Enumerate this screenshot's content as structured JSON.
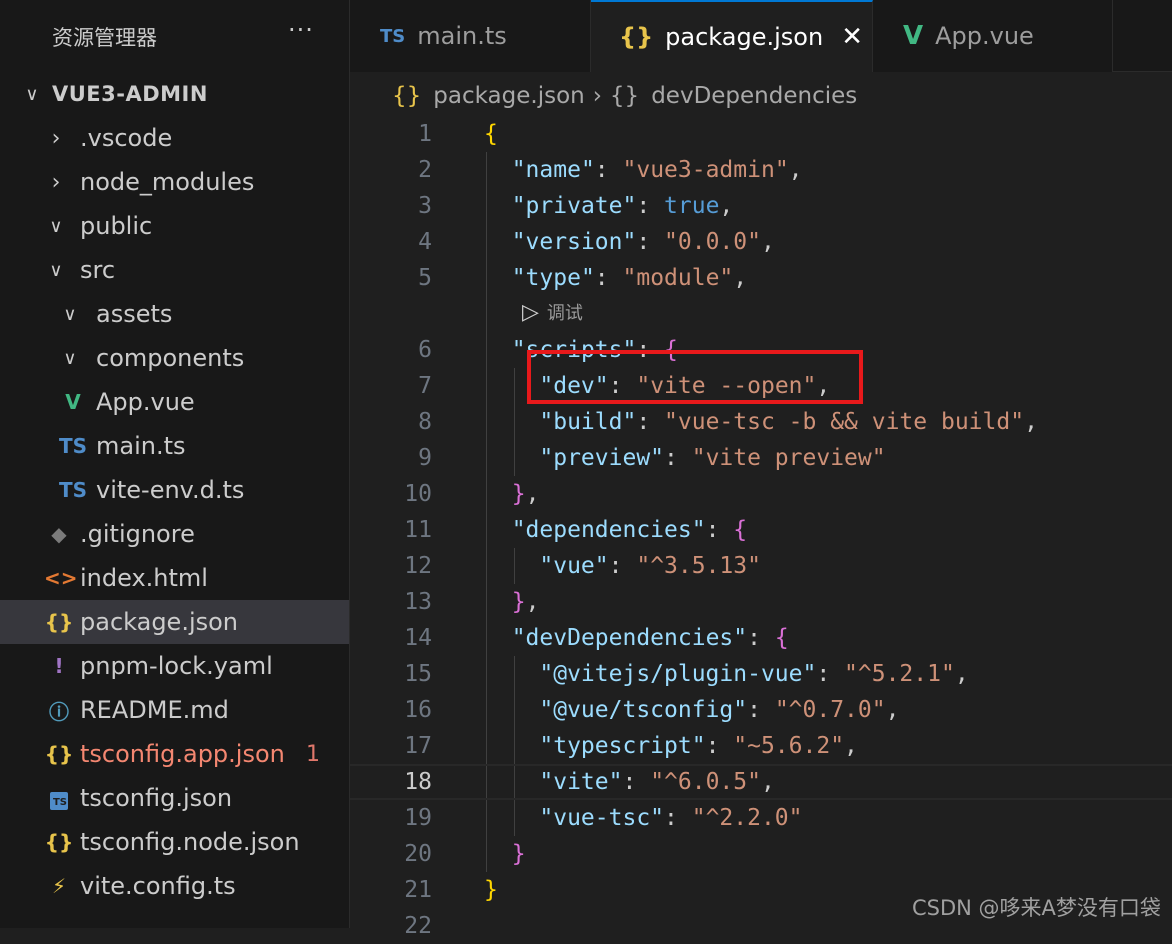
{
  "explorer": {
    "title": "资源管理器",
    "more": "···",
    "tree": [
      {
        "label": "VUE3-ADMIN",
        "icon": "chevron-down",
        "depth": 0,
        "kind": "root"
      },
      {
        "label": ".vscode",
        "icon": "chevron-right",
        "depth": 1
      },
      {
        "label": "node_modules",
        "icon": "chevron-right",
        "depth": 1
      },
      {
        "label": "public",
        "icon": "chevron-down",
        "depth": 1
      },
      {
        "label": "src",
        "icon": "chevron-down",
        "depth": 1
      },
      {
        "label": "assets",
        "icon": "chevron-down",
        "depth": 2
      },
      {
        "label": "components",
        "icon": "chevron-down",
        "depth": 2
      },
      {
        "label": "App.vue",
        "icon": "vue",
        "depth": 2
      },
      {
        "label": "main.ts",
        "icon": "ts",
        "depth": 2
      },
      {
        "label": "vite-env.d.ts",
        "icon": "ts",
        "depth": 2
      },
      {
        "label": ".gitignore",
        "icon": "git",
        "depth": 1
      },
      {
        "label": "index.html",
        "icon": "html",
        "depth": 1
      },
      {
        "label": "package.json",
        "icon": "json",
        "depth": 1,
        "selected": true
      },
      {
        "label": "pnpm-lock.yaml",
        "icon": "yaml",
        "depth": 1
      },
      {
        "label": "README.md",
        "icon": "info",
        "depth": 1
      },
      {
        "label": "tsconfig.app.json",
        "icon": "json",
        "depth": 1,
        "error": true,
        "badge": "1"
      },
      {
        "label": "tsconfig.json",
        "icon": "tsconfig",
        "depth": 1
      },
      {
        "label": "tsconfig.node.json",
        "icon": "json",
        "depth": 1
      },
      {
        "label": "vite.config.ts",
        "icon": "vite",
        "depth": 1
      }
    ]
  },
  "tabs": [
    {
      "label": "main.ts",
      "icon": "TS",
      "active": false
    },
    {
      "label": "package.json",
      "icon": "{}",
      "active": true,
      "close": "✕"
    },
    {
      "label": "App.vue",
      "icon": "V",
      "active": false
    }
  ],
  "breadcrumb": [
    {
      "icon": "{}",
      "label": "package.json"
    },
    {
      "icon": "{}",
      "label": "devDependencies"
    }
  ],
  "codelens": {
    "label": "调试"
  },
  "editor": {
    "current_line": 18,
    "lines": [
      {
        "n": "1",
        "t": [
          [
            "{",
            "br1"
          ]
        ]
      },
      {
        "n": "2",
        "t": [
          [
            "  ",
            "p"
          ],
          [
            "\"name\"",
            "k"
          ],
          [
            ": ",
            "p"
          ],
          [
            "\"vue3-admin\"",
            "s"
          ],
          [
            ",",
            "p"
          ]
        ]
      },
      {
        "n": "3",
        "t": [
          [
            "  ",
            "p"
          ],
          [
            "\"private\"",
            "k"
          ],
          [
            ": ",
            "p"
          ],
          [
            "true",
            "b"
          ],
          [
            ",",
            "p"
          ]
        ]
      },
      {
        "n": "4",
        "t": [
          [
            "  ",
            "p"
          ],
          [
            "\"version\"",
            "k"
          ],
          [
            ": ",
            "p"
          ],
          [
            "\"0.0.0\"",
            "s"
          ],
          [
            ",",
            "p"
          ]
        ]
      },
      {
        "n": "5",
        "t": [
          [
            "  ",
            "p"
          ],
          [
            "\"type\"",
            "k"
          ],
          [
            ": ",
            "p"
          ],
          [
            "\"module\"",
            "s"
          ],
          [
            ",",
            "p"
          ]
        ]
      },
      {
        "n": "6",
        "t": [
          [
            "  ",
            "p"
          ],
          [
            "\"scripts\"",
            "k"
          ],
          [
            ": ",
            "p"
          ],
          [
            "{",
            "br2"
          ]
        ]
      },
      {
        "n": "7",
        "t": [
          [
            "    ",
            "p"
          ],
          [
            "\"dev\"",
            "k"
          ],
          [
            ": ",
            "p"
          ],
          [
            "\"vite --open\"",
            "s"
          ],
          [
            ",",
            "p"
          ]
        ]
      },
      {
        "n": "8",
        "t": [
          [
            "    ",
            "p"
          ],
          [
            "\"build\"",
            "k"
          ],
          [
            ": ",
            "p"
          ],
          [
            "\"vue-tsc -b && vite build\"",
            "s"
          ],
          [
            ",",
            "p"
          ]
        ]
      },
      {
        "n": "9",
        "t": [
          [
            "    ",
            "p"
          ],
          [
            "\"preview\"",
            "k"
          ],
          [
            ": ",
            "p"
          ],
          [
            "\"vite preview\"",
            "s"
          ]
        ]
      },
      {
        "n": "10",
        "t": [
          [
            "  ",
            "p"
          ],
          [
            "}",
            "br2"
          ],
          [
            ",",
            "p"
          ]
        ]
      },
      {
        "n": "11",
        "t": [
          [
            "  ",
            "p"
          ],
          [
            "\"dependencies\"",
            "k"
          ],
          [
            ": ",
            "p"
          ],
          [
            "{",
            "br2"
          ]
        ]
      },
      {
        "n": "12",
        "t": [
          [
            "    ",
            "p"
          ],
          [
            "\"vue\"",
            "k"
          ],
          [
            ": ",
            "p"
          ],
          [
            "\"^3.5.13\"",
            "s"
          ]
        ]
      },
      {
        "n": "13",
        "t": [
          [
            "  ",
            "p"
          ],
          [
            "}",
            "br2"
          ],
          [
            ",",
            "p"
          ]
        ]
      },
      {
        "n": "14",
        "t": [
          [
            "  ",
            "p"
          ],
          [
            "\"devDependencies\"",
            "k"
          ],
          [
            ": ",
            "p"
          ],
          [
            "{",
            "br2"
          ]
        ]
      },
      {
        "n": "15",
        "t": [
          [
            "    ",
            "p"
          ],
          [
            "\"@vitejs/plugin-vue\"",
            "k"
          ],
          [
            ": ",
            "p"
          ],
          [
            "\"^5.2.1\"",
            "s"
          ],
          [
            ",",
            "p"
          ]
        ]
      },
      {
        "n": "16",
        "t": [
          [
            "    ",
            "p"
          ],
          [
            "\"@vue/tsconfig\"",
            "k"
          ],
          [
            ": ",
            "p"
          ],
          [
            "\"^0.7.0\"",
            "s"
          ],
          [
            ",",
            "p"
          ]
        ]
      },
      {
        "n": "17",
        "t": [
          [
            "    ",
            "p"
          ],
          [
            "\"typescript\"",
            "k"
          ],
          [
            ": ",
            "p"
          ],
          [
            "\"~5.6.2\"",
            "s"
          ],
          [
            ",",
            "p"
          ]
        ]
      },
      {
        "n": "18",
        "t": [
          [
            "    ",
            "p"
          ],
          [
            "\"vite\"",
            "k"
          ],
          [
            ": ",
            "p"
          ],
          [
            "\"^6.0.5\"",
            "s"
          ],
          [
            ",",
            "p"
          ]
        ]
      },
      {
        "n": "19",
        "t": [
          [
            "    ",
            "p"
          ],
          [
            "\"vue-tsc\"",
            "k"
          ],
          [
            ": ",
            "p"
          ],
          [
            "\"^2.2.0\"",
            "s"
          ]
        ]
      },
      {
        "n": "20",
        "t": [
          [
            "  ",
            "p"
          ],
          [
            "}",
            "br2"
          ]
        ]
      },
      {
        "n": "21",
        "t": [
          [
            "}",
            "br1"
          ]
        ]
      },
      {
        "n": "22",
        "t": []
      }
    ]
  },
  "watermark": "CSDN @哆来A梦没有口袋",
  "colors": {
    "highlight_box": "#e8191b",
    "accent": "#0078d4"
  }
}
